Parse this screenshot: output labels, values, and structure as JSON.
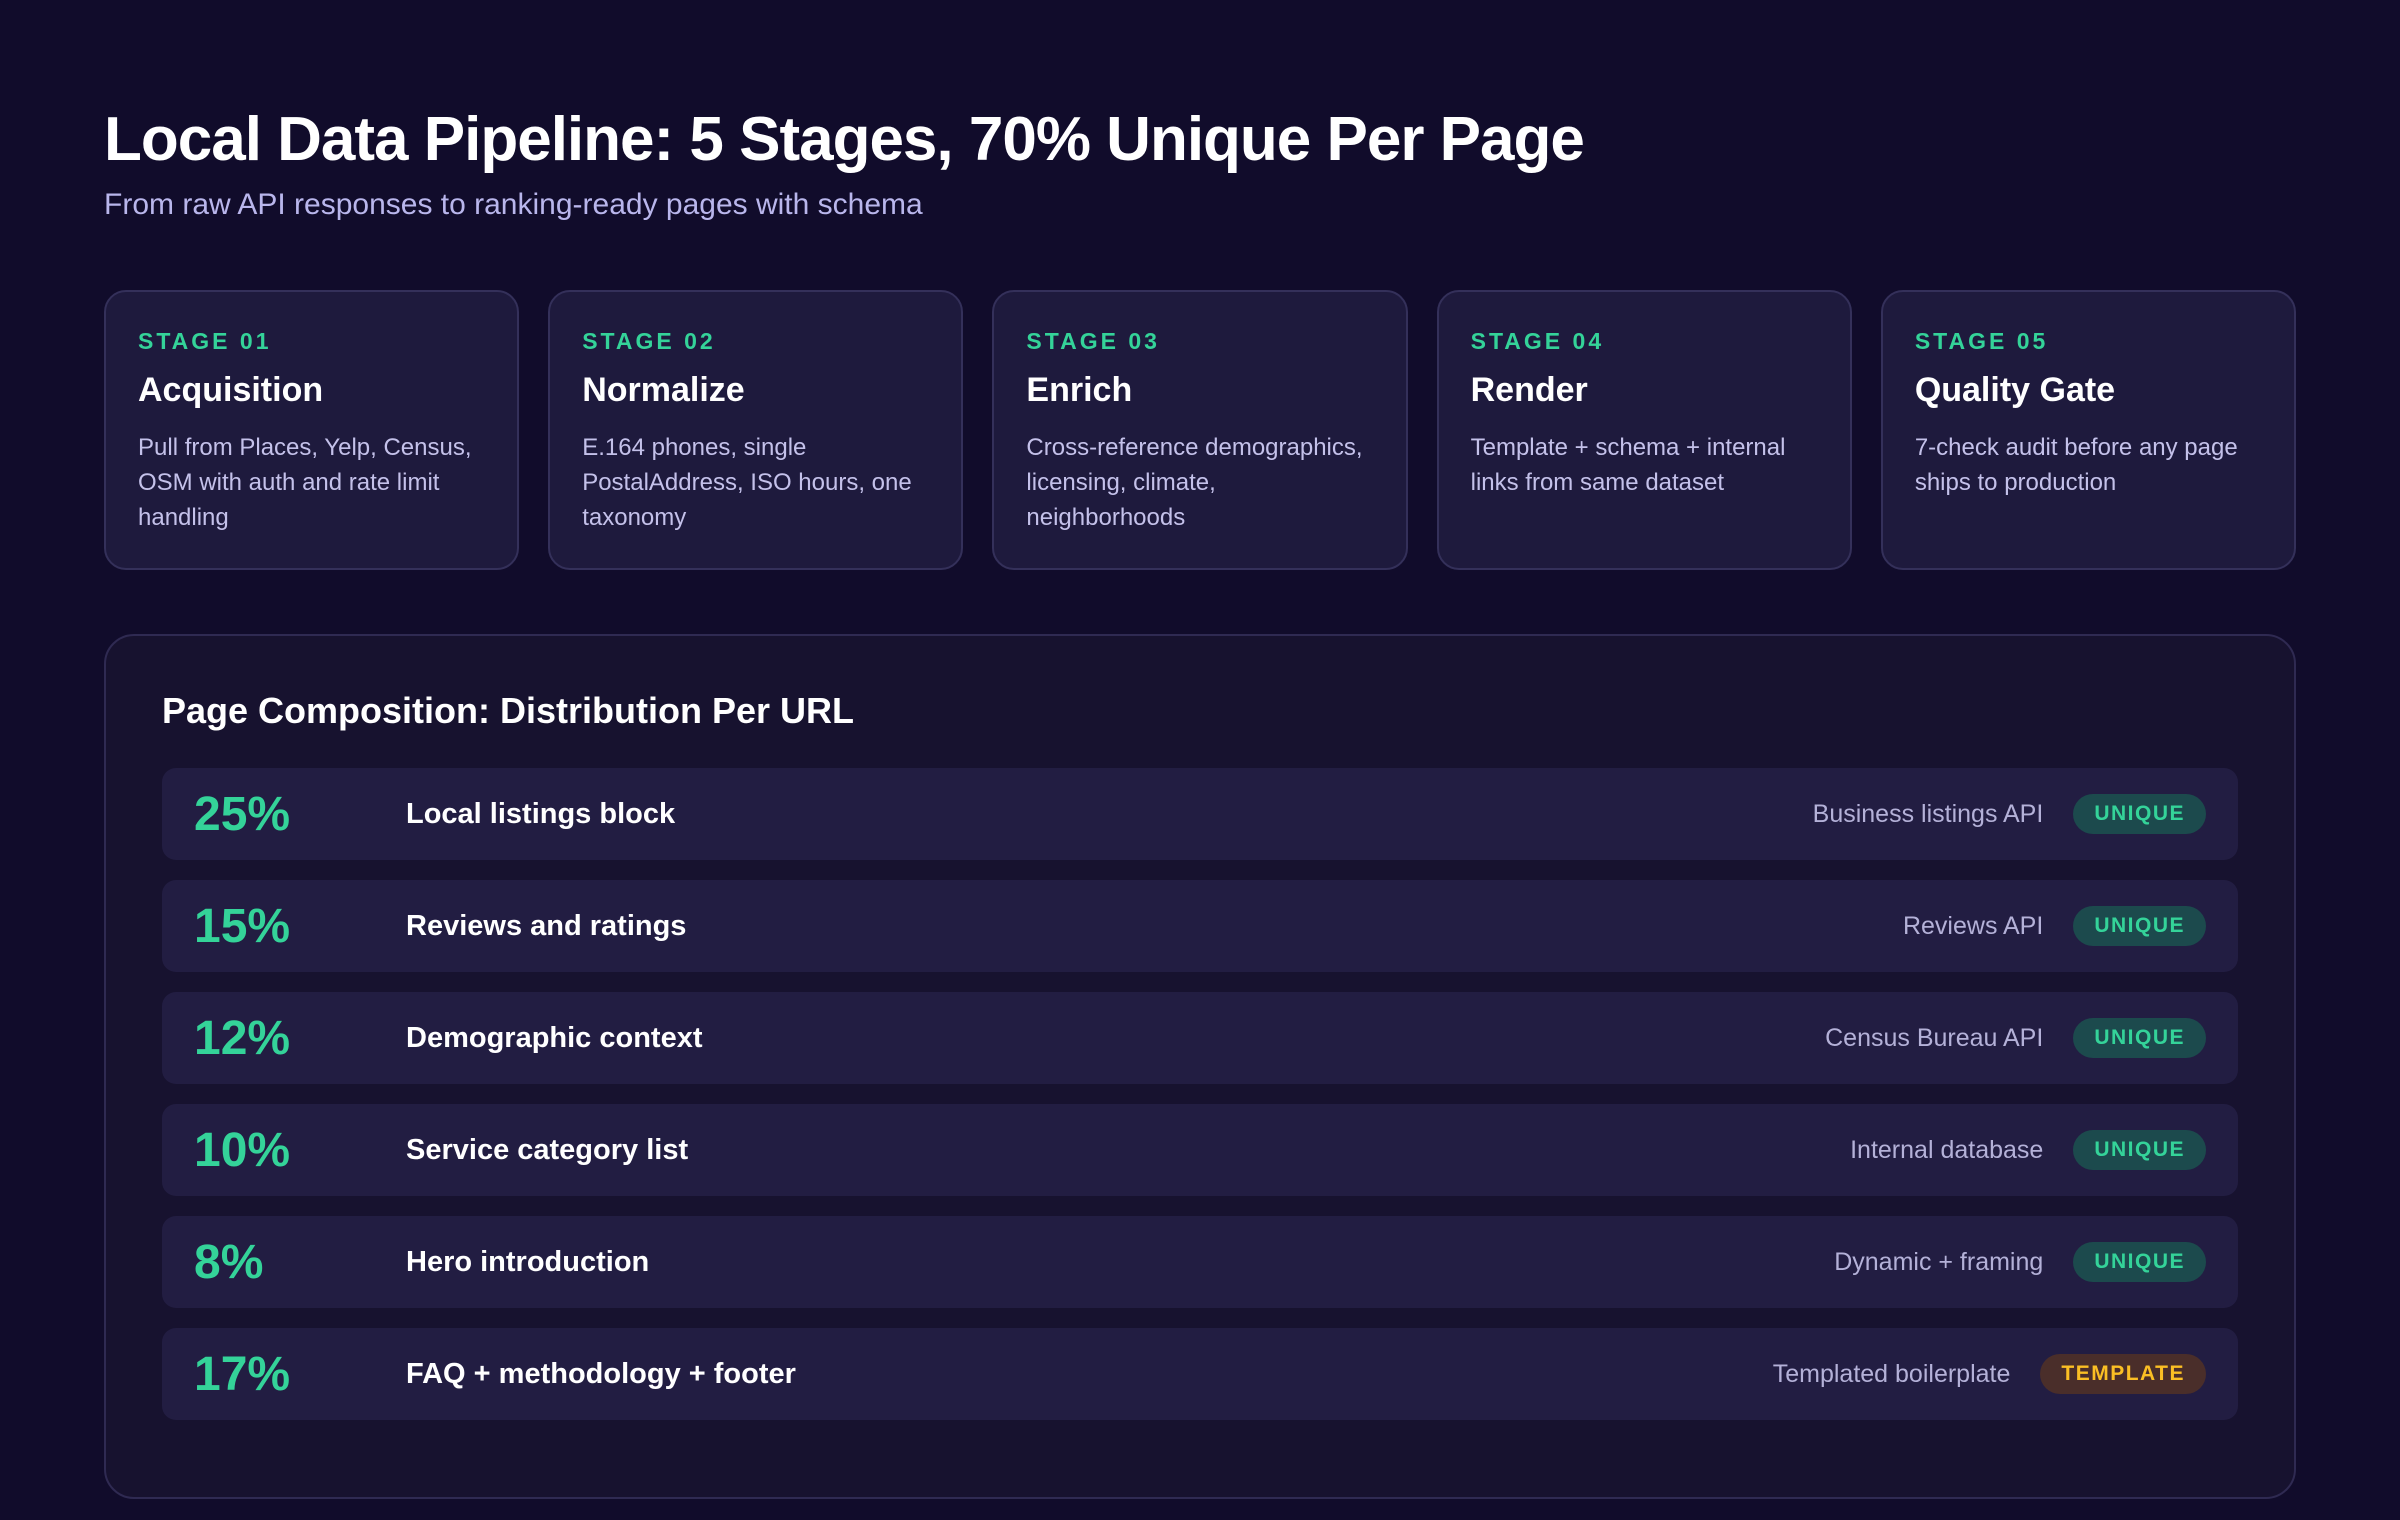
{
  "header": {
    "title": "Local Data Pipeline: 5 Stages, 70% Unique Per Page",
    "subtitle": "From raw API responses to ranking-ready pages with schema"
  },
  "stages": [
    {
      "num": "STAGE 01",
      "name": "Acquisition",
      "desc": "Pull from Places, Yelp, Census, OSM with auth and rate limit handling"
    },
    {
      "num": "STAGE 02",
      "name": "Normalize",
      "desc": "E.164 phones, single PostalAddress, ISO hours, one taxonomy"
    },
    {
      "num": "STAGE 03",
      "name": "Enrich",
      "desc": "Cross-reference demographics, licensing, climate, neighborhoods"
    },
    {
      "num": "STAGE 04",
      "name": "Render",
      "desc": "Template + schema + internal links from same dataset"
    },
    {
      "num": "STAGE 05",
      "name": "Quality Gate",
      "desc": "7-check audit before any page ships to production"
    }
  ],
  "composition": {
    "title": "Page Composition: Distribution Per URL",
    "rows": [
      {
        "pct": "25%",
        "label": "Local listings block",
        "source": "Business listings API",
        "badge": "UNIQUE"
      },
      {
        "pct": "15%",
        "label": "Reviews and ratings",
        "source": "Reviews API",
        "badge": "UNIQUE"
      },
      {
        "pct": "12%",
        "label": "Demographic context",
        "source": "Census Bureau API",
        "badge": "UNIQUE"
      },
      {
        "pct": "10%",
        "label": "Service category list",
        "source": "Internal database",
        "badge": "UNIQUE"
      },
      {
        "pct": "8%",
        "label": "Hero introduction",
        "source": "Dynamic + framing",
        "badge": "UNIQUE"
      },
      {
        "pct": "17%",
        "label": "FAQ + methodology + footer",
        "source": "Templated boilerplate",
        "badge": "TEMPLATE"
      }
    ]
  },
  "colors": {
    "background": "#110c2b",
    "accent_green": "#34d399",
    "accent_amber": "#fbbf24"
  }
}
